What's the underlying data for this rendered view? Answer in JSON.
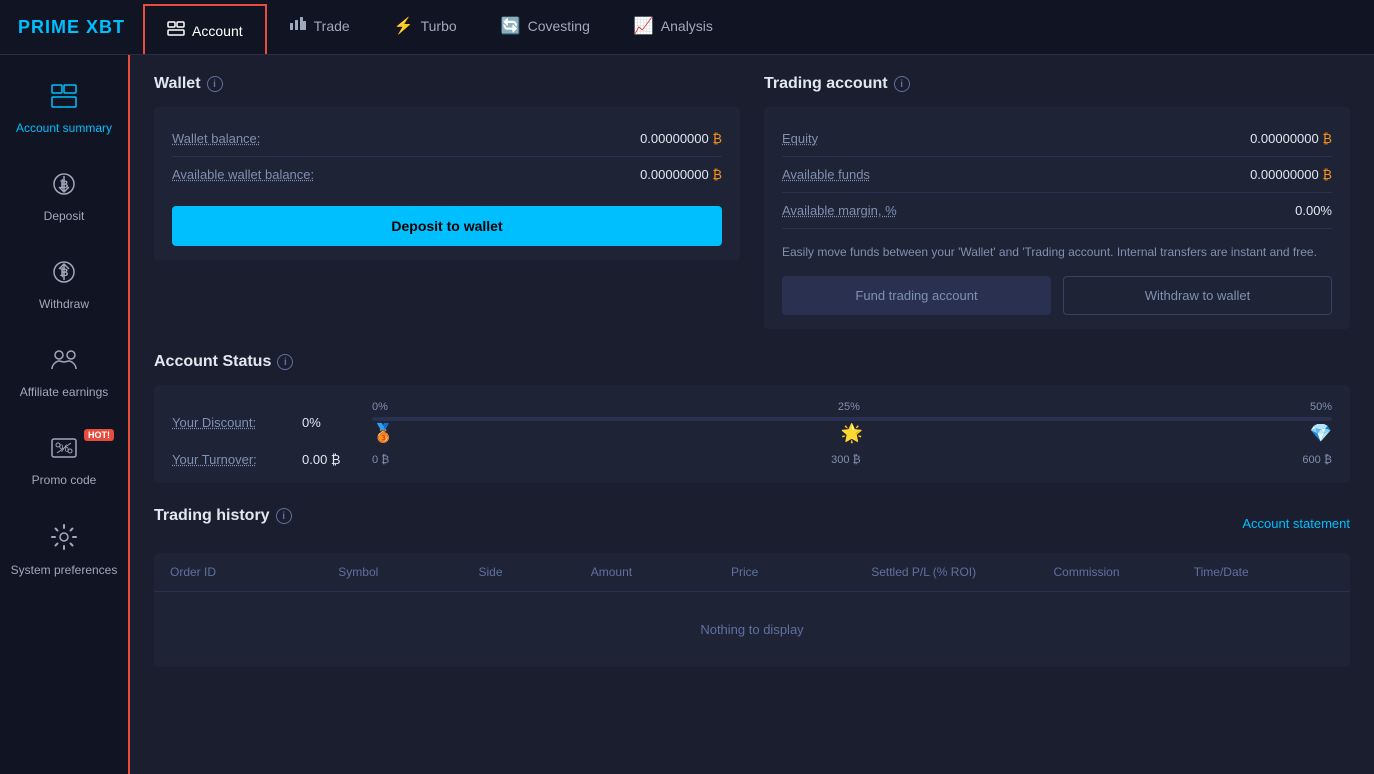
{
  "logo": {
    "prime": "PRIME",
    "xbt": " XBT"
  },
  "nav": {
    "items": [
      {
        "id": "account",
        "label": "Account",
        "icon": "🗂",
        "active": true
      },
      {
        "id": "trade",
        "label": "Trade",
        "icon": "📊",
        "active": false
      },
      {
        "id": "turbo",
        "label": "Turbo",
        "icon": "⚡",
        "active": false
      },
      {
        "id": "covesting",
        "label": "Covesting",
        "icon": "🔄",
        "active": false
      },
      {
        "id": "analysis",
        "label": "Analysis",
        "icon": "📈",
        "active": false
      }
    ]
  },
  "sidebar": {
    "items": [
      {
        "id": "account-summary",
        "label": "Account summary",
        "icon": "🗃",
        "active": true
      },
      {
        "id": "deposit",
        "label": "Deposit",
        "icon": "₿↓",
        "active": false
      },
      {
        "id": "withdraw",
        "label": "Withdraw",
        "icon": "₿↑",
        "active": false
      },
      {
        "id": "affiliate",
        "label": "Affiliate earnings",
        "icon": "👥",
        "active": false
      },
      {
        "id": "promo",
        "label": "Promo code",
        "icon": "🏷",
        "active": false,
        "hot": true
      },
      {
        "id": "system",
        "label": "System preferences",
        "icon": "⚙",
        "active": false
      }
    ]
  },
  "wallet": {
    "section_title": "Wallet",
    "wallet_balance_label": "Wallet balance:",
    "wallet_balance_value": "0.00000000",
    "available_balance_label": "Available wallet balance:",
    "available_balance_value": "0.00000000",
    "deposit_btn": "Deposit to wallet"
  },
  "trading_account": {
    "section_title": "Trading account",
    "equity_label": "Equity",
    "equity_value": "0.00000000",
    "available_funds_label": "Available funds",
    "available_funds_value": "0.00000000",
    "available_margin_label": "Available margin, %",
    "available_margin_value": "0.00%",
    "description": "Easily move funds between your 'Wallet' and 'Trading account. Internal transfers are instant and free.",
    "fund_btn": "Fund trading account",
    "withdraw_btn": "Withdraw to wallet"
  },
  "account_status": {
    "section_title": "Account Status",
    "discount_label": "Your Discount:",
    "discount_value": "0%",
    "turnover_label": "Your Turnover:",
    "turnover_value": "0.00 ₿",
    "progress_labels": [
      "0%",
      "25%",
      "50%"
    ],
    "progress_markers": [
      "0 ₿",
      "300 ₿",
      "600 ₿"
    ]
  },
  "trading_history": {
    "section_title": "Trading history",
    "account_statement_link": "Account statement",
    "columns": [
      "Order ID",
      "Symbol",
      "Side",
      "Amount",
      "Price",
      "Settled P/L (% ROI)",
      "Commission",
      "Time/Date"
    ],
    "empty_message": "Nothing to display"
  }
}
